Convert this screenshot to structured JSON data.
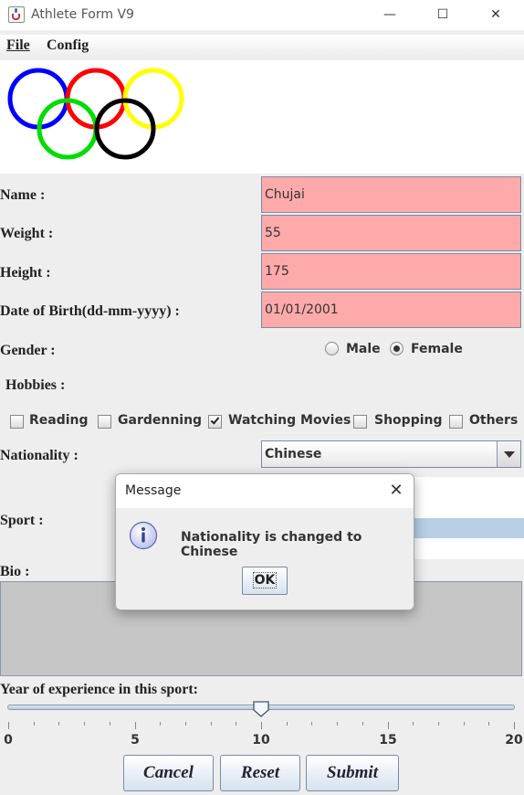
{
  "window": {
    "title": "Athlete Form V9",
    "min_symbol": "—",
    "max_symbol": "☐",
    "close_symbol": "✕"
  },
  "menu": {
    "file": "File",
    "config": "Config"
  },
  "form": {
    "name_label": "Name :",
    "name_value": "Chujai",
    "weight_label": "Weight :",
    "weight_value": "55",
    "height_label": "Height :",
    "height_value": "175",
    "dob_label": "Date of Birth(dd-mm-yyyy) :",
    "dob_value": "01/01/2001",
    "gender_label": "Gender :",
    "gender_options": [
      "Male",
      "Female"
    ],
    "gender_selected": "Female",
    "hobbies_label": "Hobbies :",
    "hobbies": [
      {
        "label": "Reading",
        "checked": false
      },
      {
        "label": "Gardenning",
        "checked": false
      },
      {
        "label": "Watching Movies",
        "checked": true
      },
      {
        "label": "Shopping",
        "checked": false
      },
      {
        "label": "Others",
        "checked": false
      }
    ],
    "nationality_label": "Nationality :",
    "nationality_value": "Chinese",
    "sport_label": "Sport :",
    "bio_label": "Bio :",
    "experience_label": "Year of experience in this sport:",
    "experience_value": 10,
    "slider_min": 0,
    "slider_max": 20,
    "slider_ticks": [
      "0",
      "5",
      "10",
      "15",
      "20"
    ]
  },
  "buttons": {
    "cancel": "Cancel",
    "reset": "Reset",
    "submit": "Submit"
  },
  "dialog": {
    "title": "Message",
    "message": "Nationality is changed to Chinese",
    "ok": "OK",
    "close_symbol": "✕"
  },
  "colors": {
    "field_bg": "#ffaaaa",
    "ring_blue": "#0000ff",
    "ring_red": "#ff0000",
    "ring_yellow": "#ffff00",
    "ring_green": "#00dd00",
    "ring_black": "#000000"
  }
}
